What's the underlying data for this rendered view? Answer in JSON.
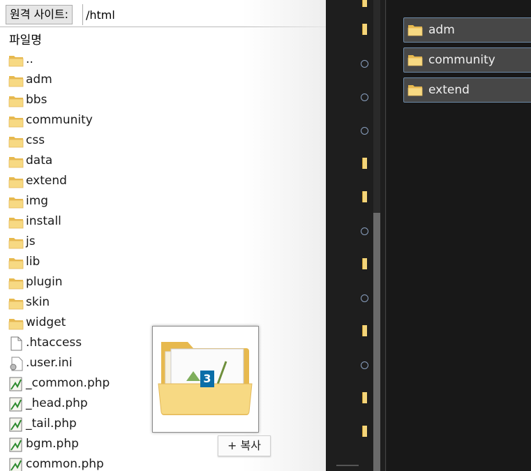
{
  "remote": {
    "label": "원격 사이트:",
    "path": "/html",
    "column_header": "파일명"
  },
  "files": [
    {
      "name": "..",
      "icon": "folder-icon"
    },
    {
      "name": "adm",
      "icon": "folder-icon"
    },
    {
      "name": "bbs",
      "icon": "folder-icon"
    },
    {
      "name": "community",
      "icon": "folder-icon"
    },
    {
      "name": "css",
      "icon": "folder-icon"
    },
    {
      "name": "data",
      "icon": "folder-icon"
    },
    {
      "name": "extend",
      "icon": "folder-icon"
    },
    {
      "name": "img",
      "icon": "folder-icon"
    },
    {
      "name": "install",
      "icon": "folder-icon"
    },
    {
      "name": "js",
      "icon": "folder-icon"
    },
    {
      "name": "lib",
      "icon": "folder-icon"
    },
    {
      "name": "plugin",
      "icon": "folder-icon"
    },
    {
      "name": "skin",
      "icon": "folder-icon"
    },
    {
      "name": "widget",
      "icon": "folder-icon"
    },
    {
      "name": ".htaccess",
      "icon": "file-icon"
    },
    {
      "name": ".user.ini",
      "icon": "settings-file-icon"
    },
    {
      "name": "_common.php",
      "icon": "php-file-icon"
    },
    {
      "name": "_head.php",
      "icon": "php-file-icon"
    },
    {
      "name": "_tail.php",
      "icon": "php-file-icon"
    },
    {
      "name": "bgm.php",
      "icon": "php-file-icon"
    },
    {
      "name": "common.php",
      "icon": "php-file-icon"
    }
  ],
  "drag": {
    "count": "3",
    "tooltip": "+ 복사"
  },
  "right_folders": [
    {
      "name": "adm",
      "icon": "folder-icon"
    },
    {
      "name": "community",
      "icon": "folder-icon"
    },
    {
      "name": "extend",
      "icon": "folder-icon"
    }
  ],
  "colors": {
    "folder": "#f4d57a",
    "folder_edge": "#d9a73b",
    "badge": "#0a6ea8",
    "dark_bg": "#181818"
  }
}
